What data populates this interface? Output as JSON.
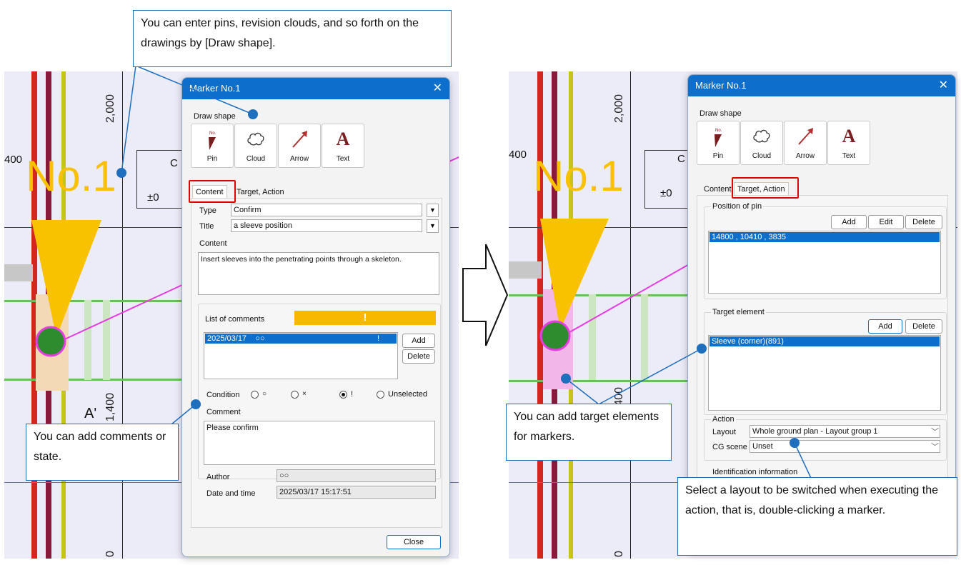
{
  "callouts": {
    "draw_shape": "You can enter pins, revision clouds, and so forth on the drawings by [Draw shape].",
    "comments": "You can add comments or state.",
    "target": "You can add target elements for markers.",
    "layout": "Select a layout to be switched when executing the action, that is, double-clicking a marker."
  },
  "drawing": {
    "marker_label": "No.1",
    "dim_2000": "2,000",
    "dim_400": "400",
    "dim_1400": "1,400",
    "label_a": "A'",
    "label_pm0": "±0",
    "label_c": "C",
    "dim_0": "0"
  },
  "left_dialog": {
    "title": "Marker   No.1",
    "close_glyph": "✕",
    "draw_shape_label": "Draw shape",
    "shapes": [
      "Pin",
      "Cloud",
      "Arrow",
      "Text"
    ],
    "pin_mark": "No.",
    "text_glyph": "A",
    "tabs": [
      "Content",
      "Target, Action"
    ],
    "type_label": "Type",
    "type_value": "Confirm",
    "title_label": "Title",
    "title_value": "a sleeve position",
    "content_label": "Content",
    "content_value": "Insert sleeves into the penetrating points through a skeleton.",
    "comments_label": "List of comments",
    "comments_status_glyph": "!",
    "comment_row_date": "2025/03/17",
    "comment_row_author": "○○",
    "comment_row_state": "!",
    "add_label": "Add",
    "delete_label": "Delete",
    "condition_label": "Condition",
    "conditions": [
      "○",
      "×",
      "!",
      "Unselected"
    ],
    "comment_label": "Comment",
    "comment_value": "Please confirm",
    "author_label": "Author",
    "author_value": "○○",
    "datetime_label": "Date and time",
    "datetime_value": "2025/03/17 15:17:51",
    "close_label": "Close"
  },
  "right_dialog": {
    "title": "Marker   No.1",
    "close_glyph": "✕",
    "draw_shape_label": "Draw shape",
    "shapes": [
      "Pin",
      "Cloud",
      "Arrow",
      "Text"
    ],
    "pin_mark": "No.",
    "text_glyph": "A",
    "tabs": [
      "Content",
      "Target, Action"
    ],
    "position_group": "Position of pin",
    "add_label": "Add",
    "edit_label": "Edit",
    "delete_label": "Delete",
    "position_value": "14800 , 10410 , 3835",
    "target_group": "Target element",
    "target_value": "Sleeve (corner)(891)",
    "action_group": "Action",
    "layout_label": "Layout",
    "layout_value": "Whole ground plan - Layout group 1",
    "cg_label": "CG scene",
    "cg_value": "Unset",
    "ident_label": "Identification information"
  },
  "colors": {
    "accent": "#0d6fcb",
    "highlight_red": "#e00000",
    "marker_yellow": "#f9c200",
    "callout_blue": "#1f6fbf"
  }
}
